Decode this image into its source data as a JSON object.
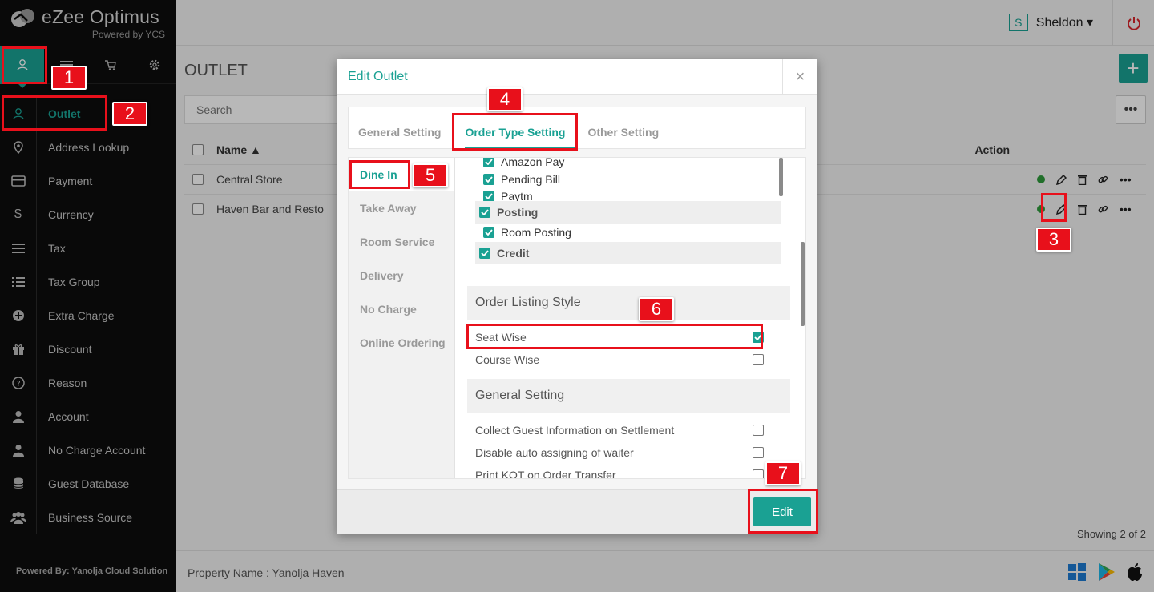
{
  "app": {
    "title": "eZee Optimus",
    "subtitle": "Powered by YCS"
  },
  "sidebar": {
    "items": [
      {
        "label": "Outlet",
        "icon": "user-icon",
        "active": true
      },
      {
        "label": "Address Lookup",
        "icon": "map-pin-icon"
      },
      {
        "label": "Payment",
        "icon": "credit-card-icon"
      },
      {
        "label": "Currency",
        "icon": "dollar-icon"
      },
      {
        "label": "Tax",
        "icon": "lines-icon"
      },
      {
        "label": "Tax Group",
        "icon": "list-icon"
      },
      {
        "label": "Extra Charge",
        "icon": "plus-circle-icon"
      },
      {
        "label": "Discount",
        "icon": "gift-icon"
      },
      {
        "label": "Reason",
        "icon": "question-circle-icon"
      },
      {
        "label": "Account",
        "icon": "person-icon"
      },
      {
        "label": "No Charge Account",
        "icon": "person-icon"
      },
      {
        "label": "Guest Database",
        "icon": "database-icon"
      },
      {
        "label": "Business Source",
        "icon": "users-icon"
      }
    ],
    "footer": "Powered By: Yanolja Cloud Solution"
  },
  "header": {
    "user_initial": "S",
    "user_name": "Sheldon ▾"
  },
  "main": {
    "title": "OUTLET",
    "search_placeholder": "Search",
    "columns": {
      "name": "Name ▲",
      "action": "Action"
    },
    "rows": [
      {
        "name": "Central Store"
      },
      {
        "name": "Haven Bar and Resto"
      }
    ],
    "showing": "Showing 2 of 2",
    "property": "Property Name : Yanolja Haven"
  },
  "modal": {
    "title": "Edit Outlet",
    "close": "×",
    "tabs": [
      "General Setting",
      "Order Type Setting",
      "Other Setting"
    ],
    "sub_tabs": [
      "Dine In",
      "Take Away",
      "Room Service",
      "Delivery",
      "No Charge",
      "Online Ordering"
    ],
    "payments": [
      "Amazon Pay",
      "Pending Bill",
      "Paytm"
    ],
    "posting_group": "Posting",
    "room_posting": "Room Posting",
    "credit_group": "Credit",
    "order_listing": {
      "title": "Order Listing Style",
      "options": [
        {
          "label": "Seat Wise",
          "checked": true
        },
        {
          "label": "Course Wise",
          "checked": false
        }
      ]
    },
    "general": {
      "title": "General Setting",
      "options": [
        {
          "label": "Collect Guest Information on Settlement",
          "checked": false
        },
        {
          "label": "Disable auto assigning of waiter",
          "checked": false
        },
        {
          "label": "Print KOT on Order Transfer",
          "checked": false
        }
      ]
    },
    "edit_button": "Edit"
  },
  "annotations": [
    "1",
    "2",
    "3",
    "4",
    "5",
    "6",
    "7"
  ],
  "colors": {
    "accent": "#1aa193",
    "highlight": "#e8101b",
    "sidebar": "#0d0d0d"
  }
}
